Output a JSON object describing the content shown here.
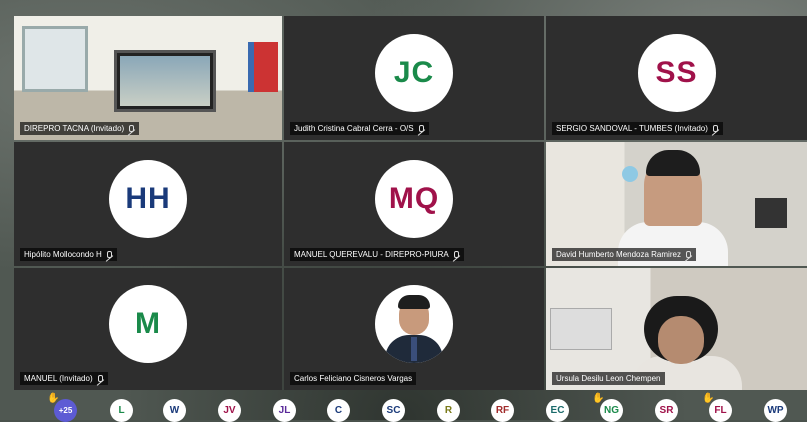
{
  "colors": {
    "tile_bg": "#2e2e2e",
    "avatar_text": [
      "#1a8a4a",
      "#a0124a",
      "#1a3a7a",
      "#a0124a",
      "#1a8a4a"
    ],
    "raised_hand": "#f3c21a",
    "more_chip": "#5d5bd4"
  },
  "tiles": [
    {
      "type": "video",
      "name": "DIREPRO TACNA (Invitado)",
      "muted": true
    },
    {
      "type": "initials",
      "initials": "JC",
      "color": "#1a8a4a",
      "name": "Judith Cristina Cabral Cerra - O/S",
      "muted": true
    },
    {
      "type": "initials",
      "initials": "SS",
      "color": "#a0124a",
      "name": "SERGIO SANDOVAL - TUMBES (Invitado)",
      "muted": true
    },
    {
      "type": "initials",
      "initials": "HH",
      "color": "#1a3a7a",
      "name": "Hipólito Mollocondo H",
      "muted": true
    },
    {
      "type": "initials",
      "initials": "MQ",
      "color": "#a0124a",
      "name": "MANUEL QUEREVALU - DIREPRO-PIURA",
      "muted": true
    },
    {
      "type": "video",
      "name": "David Humberto Mendoza Ramirez",
      "muted": true
    },
    {
      "type": "initials",
      "initials": "M",
      "color": "#1a8a4a",
      "name": "MANUEL (Invitado)",
      "muted": true
    },
    {
      "type": "photo",
      "name": "Carlos Feliciano Cisneros Vargas",
      "muted": false
    },
    {
      "type": "video",
      "name": "Ursula Desilu Leon Chempen",
      "muted": false
    }
  ],
  "participants_bar": {
    "more_label": "+25",
    "chips": [
      {
        "label": "L",
        "color": "#1a8a4a",
        "hand": false
      },
      {
        "label": "W",
        "color": "#1a3a7a",
        "hand": false
      },
      {
        "label": "JV",
        "color": "#a0124a",
        "hand": false
      },
      {
        "label": "JL",
        "color": "#5a2a9a",
        "hand": false
      },
      {
        "label": "C",
        "color": "#1a3a7a",
        "hand": false
      },
      {
        "label": "SC",
        "color": "#1a3a7a",
        "hand": false
      },
      {
        "label": "R",
        "color": "#7a7a1a",
        "hand": false
      },
      {
        "label": "RF",
        "color": "#a02a2a",
        "hand": false
      },
      {
        "label": "EC",
        "color": "#1a6a6a",
        "hand": false
      },
      {
        "label": "NG",
        "color": "#1a8a4a",
        "hand": true
      },
      {
        "label": "SR",
        "color": "#a0124a",
        "hand": false
      },
      {
        "label": "FL",
        "color": "#a0124a",
        "hand": true
      },
      {
        "label": "WP",
        "color": "#1a3a7a",
        "hand": false
      }
    ],
    "icons": {
      "raised_hand": "raised-hand-icon",
      "mic_off": "mic-off-icon"
    }
  }
}
